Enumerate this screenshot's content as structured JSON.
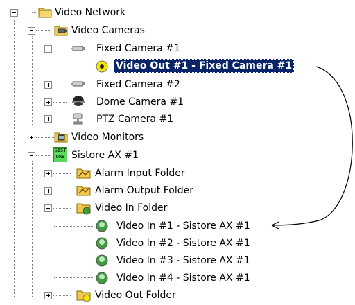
{
  "tree": {
    "root": "Video Network",
    "video_cameras": "Video Cameras",
    "fixed_camera_1": "Fixed Camera #1",
    "video_out_1": "Video Out #1 - Fixed Camera #1",
    "fixed_camera_2": "Fixed Camera #2",
    "dome_camera_1": "Dome Camera #1",
    "ptz_camera_1": "PTZ Camera #1",
    "video_monitors": "Video Monitors",
    "sistore": "Sistore AX #1",
    "sistore_badge_top": "SIST",
    "sistore_badge_bottom": "ORE",
    "alarm_input_folder": "Alarm Input Folder",
    "alarm_output_folder": "Alarm Output Folder",
    "video_in_folder": "Video In Folder",
    "video_in_1": "Video In #1 - Sistore AX #1",
    "video_in_2": "Video In #2 - Sistore AX #1",
    "video_in_3": "Video In #3 - Sistore AX #1",
    "video_in_4": "Video In #4 - Sistore AX #1",
    "video_out_folder": "Video Out Folder"
  },
  "colors": {
    "selection": "#0a246a",
    "folder": "#f2c94c",
    "video_in_green": "#3f9d3f",
    "video_out_yellow": "#f5e400"
  },
  "icons": {
    "folder": "folder-icon",
    "camera": "fixed-camera-icon",
    "dome": "dome-camera-icon",
    "ptz": "ptz-camera-icon",
    "recorder": "sistore-icon",
    "video_in": "video-in-icon",
    "video_out": "video-out-icon"
  }
}
